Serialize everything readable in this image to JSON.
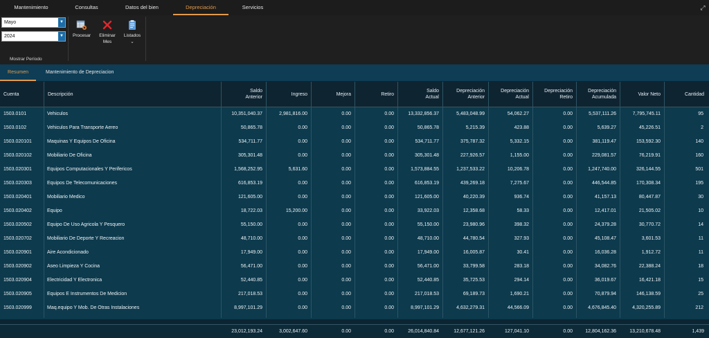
{
  "menu": {
    "tabs": [
      {
        "label": "Mantenimiento"
      },
      {
        "label": "Consultas"
      },
      {
        "label": "Datos del bien"
      },
      {
        "label": "Depreciación",
        "active": true
      },
      {
        "label": "Servicios"
      }
    ]
  },
  "ribbon": {
    "month": "Mayo",
    "year": "2024",
    "period_caption": "Mostrar Período",
    "buttons": {
      "procesar": "Procesar",
      "eliminar_line1": "Eliminar",
      "eliminar_line2": "Mes",
      "listados": "Listados"
    }
  },
  "subtabs": [
    {
      "label": "Resumen",
      "active": true
    },
    {
      "label": "Mantenimiento de Depreciacion"
    }
  ],
  "grid": {
    "columns": [
      {
        "label_lines": [
          "Cuenta"
        ]
      },
      {
        "label_lines": [
          "Descripción"
        ]
      },
      {
        "label_lines": [
          "Saldo",
          "Anterior"
        ]
      },
      {
        "label_lines": [
          "Ingreso"
        ]
      },
      {
        "label_lines": [
          "Mejora"
        ]
      },
      {
        "label_lines": [
          "Retiro"
        ]
      },
      {
        "label_lines": [
          "Saldo",
          "Actual"
        ]
      },
      {
        "label_lines": [
          "Depreciación",
          "Anterior"
        ]
      },
      {
        "label_lines": [
          "Depreciación",
          "Actual"
        ]
      },
      {
        "label_lines": [
          "Depreciación",
          "Retiro"
        ]
      },
      {
        "label_lines": [
          "Depreciación",
          "Acumulada"
        ]
      },
      {
        "label_lines": [
          "Valor Neto"
        ]
      },
      {
        "label_lines": [
          "Cantidad"
        ]
      }
    ],
    "rows": [
      [
        "1503.0101",
        "Vehiculos",
        "10,351,040.37",
        "2,981,816.00",
        "0.00",
        "0.00",
        "13,332,856.37",
        "5,483,048.99",
        "54,062.27",
        "0.00",
        "5,537,111.26",
        "7,795,745.11",
        "95"
      ],
      [
        "1503.0102",
        "Vehiculos Para Transporte Aereo",
        "50,865.78",
        "0.00",
        "0.00",
        "0.00",
        "50,865.78",
        "5,215.39",
        "423.88",
        "0.00",
        "5,639.27",
        "45,226.51",
        "2"
      ],
      [
        "1503.020101",
        "Maquinas Y Equipos De Oficina",
        "534,711.77",
        "0.00",
        "0.00",
        "0.00",
        "534,711.77",
        "375,787.32",
        "5,332.15",
        "0.00",
        "381,119.47",
        "153,592.30",
        "140"
      ],
      [
        "1503.020102",
        "Mobiliario De Oficina",
        "305,301.48",
        "0.00",
        "0.00",
        "0.00",
        "305,301.48",
        "227,926.57",
        "1,155.00",
        "0.00",
        "229,081.57",
        "76,219.91",
        "160"
      ],
      [
        "1503.020301",
        "Equipos Computacionales Y Perifericos",
        "1,568,252.95",
        "5,631.60",
        "0.00",
        "0.00",
        "1,573,884.55",
        "1,237,533.22",
        "10,206.78",
        "0.00",
        "1,247,740.00",
        "326,144.55",
        "501"
      ],
      [
        "1503.020303",
        "Equipos De Telecomunicaciones",
        "616,853.19",
        "0.00",
        "0.00",
        "0.00",
        "616,853.19",
        "439,269.18",
        "7,275.67",
        "0.00",
        "446,544.85",
        "170,308.34",
        "195"
      ],
      [
        "1503.020401",
        "Mobiliario Medico",
        "121,605.00",
        "0.00",
        "0.00",
        "0.00",
        "121,605.00",
        "40,220.39",
        "936.74",
        "0.00",
        "41,157.13",
        "80,447.87",
        "30"
      ],
      [
        "1503.020402",
        "Equipo",
        "18,722.03",
        "15,200.00",
        "0.00",
        "0.00",
        "33,922.03",
        "12,358.68",
        "58.33",
        "0.00",
        "12,417.01",
        "21,505.02",
        "10"
      ],
      [
        "1503.020502",
        "Equipo De Uso Agricola Y Pesquero",
        "55,150.00",
        "0.00",
        "0.00",
        "0.00",
        "55,150.00",
        "23,980.96",
        "398.32",
        "0.00",
        "24,379.28",
        "30,770.72",
        "14"
      ],
      [
        "1503.020702",
        "Mobiliario De Deporte Y Recreacion",
        "48,710.00",
        "0.00",
        "0.00",
        "0.00",
        "48,710.00",
        "44,780.54",
        "327.93",
        "0.00",
        "45,108.47",
        "3,601.53",
        "11"
      ],
      [
        "1503.020901",
        "Aire Acondicionado",
        "17,949.00",
        "0.00",
        "0.00",
        "0.00",
        "17,949.00",
        "16,005.87",
        "30.41",
        "0.00",
        "16,036.28",
        "1,912.72",
        "11"
      ],
      [
        "1503.020902",
        "Aseo Limpieza Y Cocina",
        "56,471.00",
        "0.00",
        "0.00",
        "0.00",
        "56,471.00",
        "33,799.58",
        "283.18",
        "0.00",
        "34,082.76",
        "22,388.24",
        "18"
      ],
      [
        "1503.020904",
        "Electricidad Y Electronica",
        "52,440.85",
        "0.00",
        "0.00",
        "0.00",
        "52,440.85",
        "35,725.53",
        "294.14",
        "0.00",
        "36,019.67",
        "16,421.18",
        "15"
      ],
      [
        "1503.020905",
        "Equipos E Instrumentos De Medicion",
        "217,018.53",
        "0.00",
        "0.00",
        "0.00",
        "217,018.53",
        "69,189.73",
        "1,690.21",
        "0.00",
        "70,879.94",
        "146,138.59",
        "25"
      ],
      [
        "1503.020999",
        "Maq.equipo Y Mob. De Otras Instalaciones",
        "8,997,101.29",
        "0.00",
        "0.00",
        "0.00",
        "8,997,101.29",
        "4,632,279.31",
        "44,566.09",
        "0.00",
        "4,676,845.40",
        "4,320,255.89",
        "212"
      ]
    ],
    "totals": [
      "23,012,193.24",
      "3,002,647.60",
      "0.00",
      "0.00",
      "26,014,840.84",
      "12,677,121.26",
      "127,041.10",
      "0.00",
      "12,804,162.36",
      "13,210,678.48",
      "1,439"
    ]
  }
}
